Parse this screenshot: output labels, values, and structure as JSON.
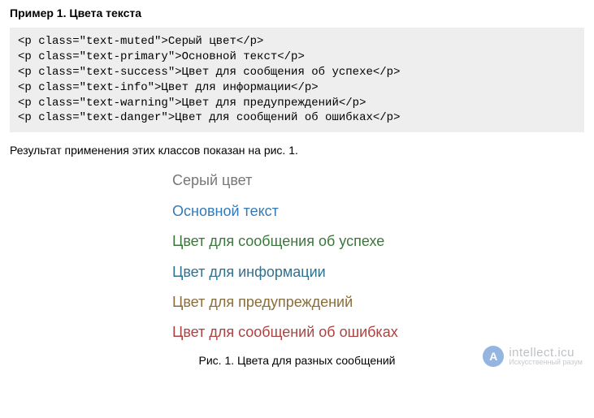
{
  "title": "Пример 1. Цвета текста",
  "code": "<p class=\"text-muted\">Серый цвет</p>\n<p class=\"text-primary\">Основной текст</p>\n<p class=\"text-success\">Цвет для сообщения об успехе</p>\n<p class=\"text-info\">Цвет для информации</p>\n<p class=\"text-warning\">Цвет для предупреждений</p>\n<p class=\"text-danger\">Цвет для сообщений об ошибках</p>",
  "result_intro": "Результат применения этих классов показан на рис. 1.",
  "samples": {
    "muted": "Серый цвет",
    "primary": "Основной текст",
    "success": "Цвет для сообщения об успехе",
    "info": "Цвет для информации",
    "warning": "Цвет для предупреждений",
    "danger": "Цвет для сообщений об ошибках"
  },
  "colors": {
    "muted": "#777777",
    "primary": "#337ab7",
    "success": "#3c763d",
    "info": "#31708f",
    "warning": "#8a6d3b",
    "danger": "#a94442"
  },
  "figure_caption": "Рис. 1. Цвета для разных сообщений",
  "watermark": {
    "glyph": "A",
    "main": "intellect.icu",
    "sub": "Искусственный разум"
  }
}
